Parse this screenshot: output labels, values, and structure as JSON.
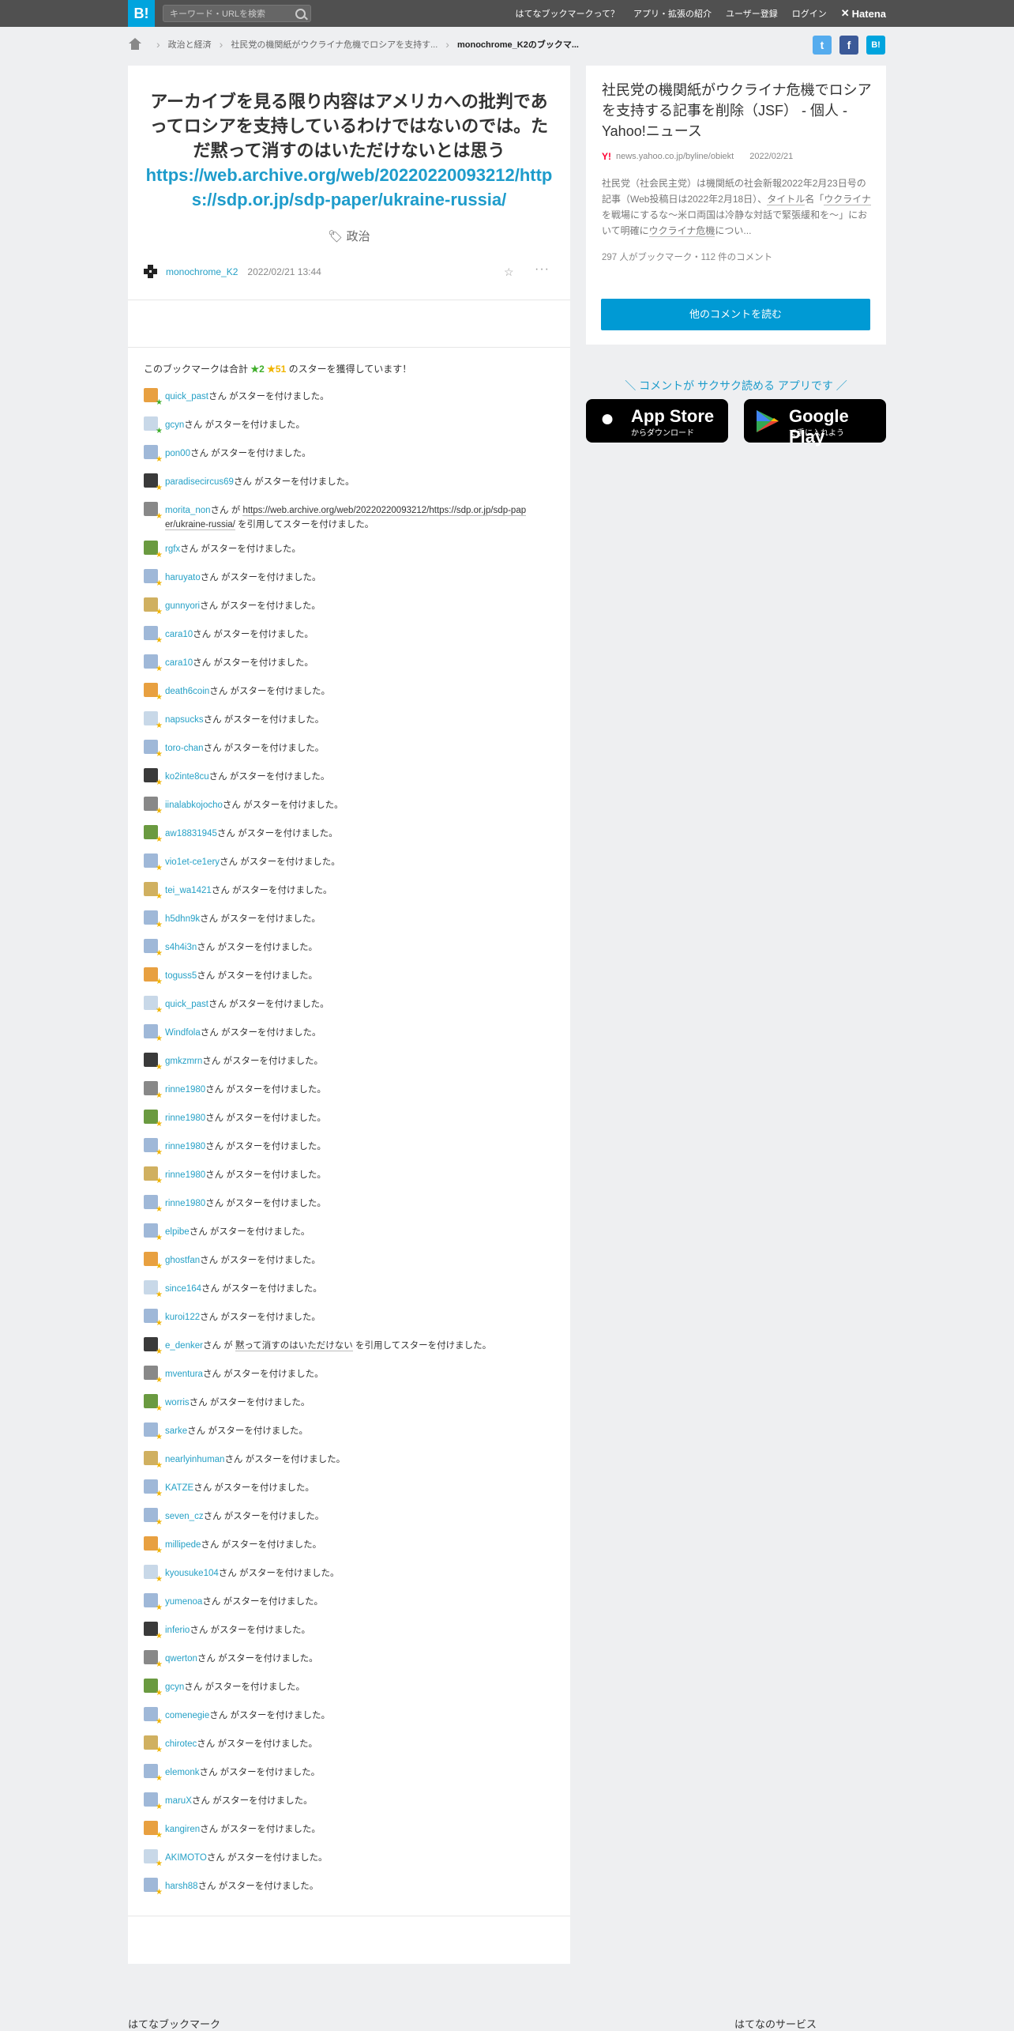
{
  "topbar": {
    "logo": "B!",
    "search_placeholder": "キーワード・URLを検索",
    "nav": [
      "はてなブックマークって？",
      "アプリ・拡張の紹介",
      "ユーザー登録",
      "ログイン"
    ],
    "brand": "Hatena"
  },
  "breadcrumb": {
    "items": [
      "政治と経済",
      "社民党の機関紙がウクライナ危機でロシアを支持す..."
    ],
    "current": "monochrome_K2のブックマ..."
  },
  "share": [
    "t",
    "f",
    "B!"
  ],
  "bookmark": {
    "comment_text": "アーカイブを見る限り内容はアメリカへの批判であってロシアを支持しているわけではないのでは。ただ黙って消すのはいただけないとは思う",
    "comment_url": "https://web.archive.org/web/20220220093212/https://sdp.or.jp/sdp-paper/ukraine-russia/",
    "tag": "政治",
    "user": "monochrome_K2",
    "date": "2022/02/21 13:44",
    "more": "···"
  },
  "stars": {
    "summary_prefix": "このブックマークは合計",
    "green": "★2",
    "yellow": "★51",
    "summary_suffix": "のスターを獲得しています！",
    "list": [
      {
        "user": "quick_past",
        "text": "さん がスターを付けました。",
        "green": true
      },
      {
        "user": "gcyn",
        "text": "さん がスターを付けました。",
        "green": true
      },
      {
        "user": "pon00",
        "text": "さん がスターを付けました。"
      },
      {
        "user": "paradisecircus69",
        "text": "さん がスターを付けました。"
      },
      {
        "user": "morita_non",
        "text": "さん が",
        "quote": "https://web.archive.org/web/20220220093212/https://sdp.or.jp/sdp-paper/ukraine-russia/",
        "after": " を引用してスターを付けました。"
      },
      {
        "user": "rgfx",
        "text": "さん がスターを付けました。"
      },
      {
        "user": "haruyato",
        "text": "さん がスターを付けました。"
      },
      {
        "user": "gunnyori",
        "text": "さん がスターを付けました。"
      },
      {
        "user": "cara10",
        "text": "さん がスターを付けました。"
      },
      {
        "user": "cara10",
        "text": "さん がスターを付けました。"
      },
      {
        "user": "death6coin",
        "text": "さん がスターを付けました。"
      },
      {
        "user": "napsucks",
        "text": "さん がスターを付けました。"
      },
      {
        "user": "toro-chan",
        "text": "さん がスターを付けました。"
      },
      {
        "user": "ko2inte8cu",
        "text": "さん がスターを付けました。"
      },
      {
        "user": "iinalabkojocho",
        "text": "さん がスターを付けました。"
      },
      {
        "user": "aw18831945",
        "text": "さん がスターを付けました。"
      },
      {
        "user": "vio1et-ce1ery",
        "text": "さん がスターを付けました。"
      },
      {
        "user": "tei_wa1421",
        "text": "さん がスターを付けました。"
      },
      {
        "user": "h5dhn9k",
        "text": "さん がスターを付けました。"
      },
      {
        "user": "s4h4i3n",
        "text": "さん がスターを付けました。"
      },
      {
        "user": "toguss5",
        "text": "さん がスターを付けました。"
      },
      {
        "user": "quick_past",
        "text": "さん がスターを付けました。"
      },
      {
        "user": "Windfola",
        "text": "さん がスターを付けました。"
      },
      {
        "user": "gmkzmrn",
        "text": "さん がスターを付けました。"
      },
      {
        "user": "rinne1980",
        "text": "さん がスターを付けました。"
      },
      {
        "user": "rinne1980",
        "text": "さん がスターを付けました。"
      },
      {
        "user": "rinne1980",
        "text": "さん がスターを付けました。"
      },
      {
        "user": "rinne1980",
        "text": "さん がスターを付けました。"
      },
      {
        "user": "rinne1980",
        "text": "さん がスターを付けました。"
      },
      {
        "user": "elpibe",
        "text": "さん がスターを付けました。"
      },
      {
        "user": "ghostfan",
        "text": "さん がスターを付けました。"
      },
      {
        "user": "since164",
        "text": "さん がスターを付けました。"
      },
      {
        "user": "kuroi122",
        "text": "さん がスターを付けました。"
      },
      {
        "user": "e_denker",
        "text": "さん が",
        "quote": "黙って消すのはいただけない",
        "after": " を引用してスターを付けました。"
      },
      {
        "user": "mventura",
        "text": "さん がスターを付けました。"
      },
      {
        "user": "worris",
        "text": "さん がスターを付けました。"
      },
      {
        "user": "sarke",
        "text": "さん がスターを付けました。"
      },
      {
        "user": "nearlyinhuman",
        "text": "さん がスターを付けました。"
      },
      {
        "user": "KATZE",
        "text": "さん がスターを付けました。"
      },
      {
        "user": "seven_cz",
        "text": "さん がスターを付けました。"
      },
      {
        "user": "millipede",
        "text": "さん がスターを付けました。"
      },
      {
        "user": "kyousuke104",
        "text": "さん がスターを付けました。"
      },
      {
        "user": "yumenoa",
        "text": "さん がスターを付けました。"
      },
      {
        "user": "inferio",
        "text": "さん がスターを付けました。"
      },
      {
        "user": "qwerton",
        "text": "さん がスターを付けました。"
      },
      {
        "user": "gcyn",
        "text": "さん がスターを付けました。"
      },
      {
        "user": "comenegie",
        "text": "さん がスターを付けました。"
      },
      {
        "user": "chirotec",
        "text": "さん がスターを付けました。"
      },
      {
        "user": "elemonk",
        "text": "さん がスターを付けました。"
      },
      {
        "user": "maruX",
        "text": "さん がスターを付けました。"
      },
      {
        "user": "kangiren",
        "text": "さん がスターを付けました。"
      },
      {
        "user": "AKIMOTO",
        "text": "さん がスターを付けました。"
      },
      {
        "user": "harsh88",
        "text": "さん がスターを付けました。"
      }
    ]
  },
  "entry": {
    "title": "社民党の機関紙がウクライナ危機でロシアを支持する記事を削除（JSF） - 個人 - Yahoo!ニュース",
    "source_icon": "Y!",
    "source": "news.yahoo.co.jp/byline/obiekt",
    "date": "2022/02/21",
    "desc_1": "社民党（社会民主党）は機関紙の社会新報2022年2月23日号の記事（Web投稿日は2022年2月18日）、",
    "desc_link1": "タイトル",
    "desc_2": "名「",
    "desc_link2": "ウクライナ",
    "desc_3": "を戦場にするな～米ロ両国は冷静な対話で緊張緩和を～」において明確に",
    "desc_link3": "ウクライナ危機",
    "desc_4": "につい...",
    "count": "297 人がブックマーク・112 件のコメント",
    "button": "他のコメントを読む"
  },
  "app": {
    "promo": "＼ コメントが サクサク読める アプリです ／",
    "appstore_big": "App Store",
    "appstore_small": "からダウンロード",
    "googleplay_big": "Google Play",
    "googleplay_small": "で手に入れよう"
  },
  "footer": {
    "left": "はてなブックマーク",
    "right": "はてなのサービス"
  },
  "colors": {
    "accent": "#00a4de",
    "link": "#25a0c6",
    "star_yellow": "#f0b400",
    "star_green": "#3fae2a",
    "twitter": "#55acee",
    "facebook": "#3b5998"
  }
}
